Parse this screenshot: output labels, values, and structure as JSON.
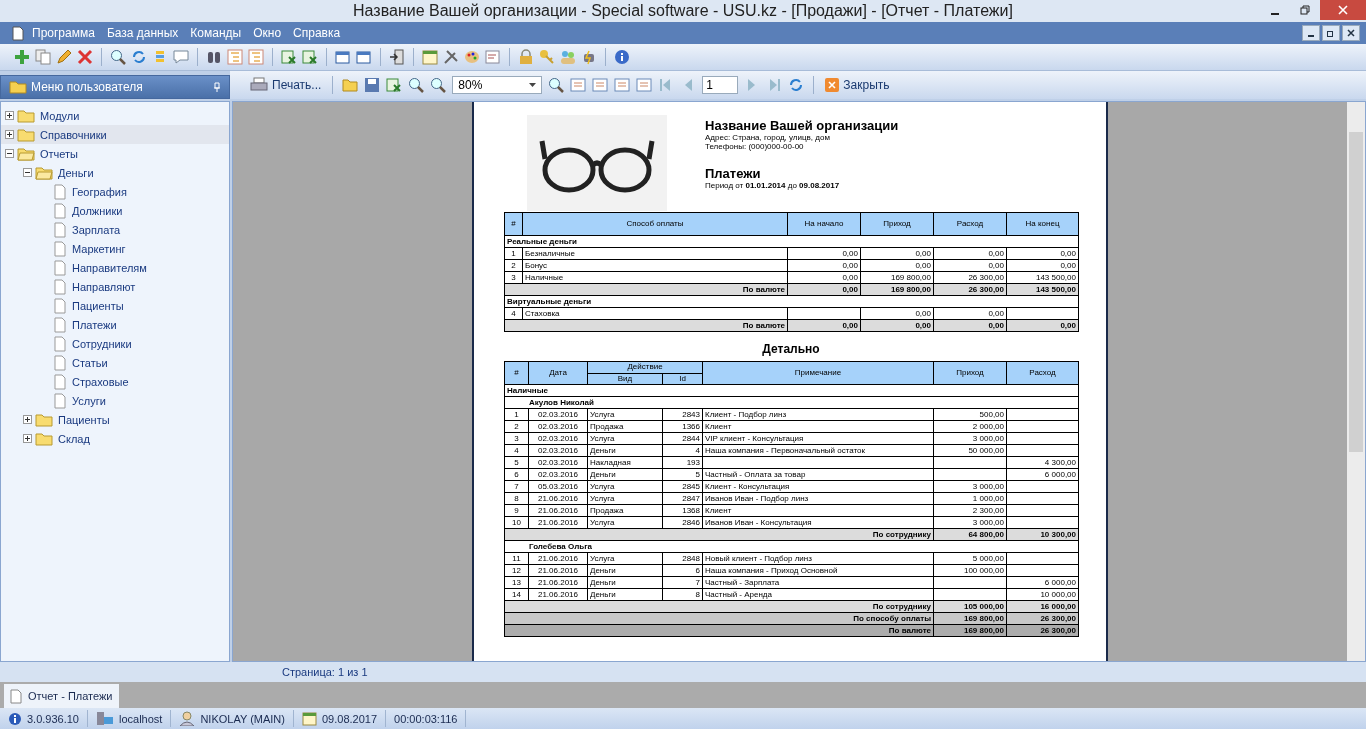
{
  "window": {
    "title": "Название Вашей организации - Special software - USU.kz - [Продажи] - [Отчет - Платежи]"
  },
  "menu": [
    "Программа",
    "База данных",
    "Команды",
    "Окно",
    "Справка"
  ],
  "sidebar": {
    "title": "Меню пользователя",
    "tree": [
      {
        "label": "Модули",
        "kind": "folder",
        "expanded": false,
        "selected": false
      },
      {
        "label": "Справочники",
        "kind": "folder",
        "expanded": false,
        "selected": true
      },
      {
        "label": "Отчеты",
        "kind": "folder",
        "expanded": true,
        "selected": false,
        "children": [
          {
            "label": "Деньги",
            "kind": "folder",
            "expanded": true,
            "selected": false,
            "children": [
              {
                "label": "География",
                "kind": "file",
                "selected": false
              },
              {
                "label": "Должники",
                "kind": "file",
                "selected": false
              },
              {
                "label": "Зарплата",
                "kind": "file",
                "selected": false
              },
              {
                "label": "Маркетинг",
                "kind": "file",
                "selected": false
              },
              {
                "label": "Направителям",
                "kind": "file",
                "selected": false
              },
              {
                "label": "Направляют",
                "kind": "file",
                "selected": false
              },
              {
                "label": "Пациенты",
                "kind": "file",
                "selected": false
              },
              {
                "label": "Платежи",
                "kind": "file",
                "selected": false
              },
              {
                "label": "Сотрудники",
                "kind": "file",
                "selected": false
              },
              {
                "label": "Статьи",
                "kind": "file",
                "selected": false
              },
              {
                "label": "Страховые",
                "kind": "file",
                "selected": false
              },
              {
                "label": "Услуги",
                "kind": "file",
                "selected": false
              }
            ]
          },
          {
            "label": "Пациенты",
            "kind": "folder",
            "expanded": false,
            "selected": false
          },
          {
            "label": "Склад",
            "kind": "folder",
            "expanded": false,
            "selected": false
          }
        ]
      }
    ]
  },
  "report_toolbar": {
    "print": "Печать...",
    "zoom": "80%",
    "page": "1",
    "close": "Закрыть"
  },
  "report": {
    "org_name": "Название Вашей организации",
    "address": "Адрес: Страна, город, улицв, дом",
    "phone": "Телефоны: (000)000-00-00",
    "title": "Платежи",
    "period": "Период от **01.01.2014** до **09.08.2017**",
    "summary": {
      "columns": [
        "#",
        "Способ оплаты",
        "На начало",
        "Приход",
        "Расход",
        "На конец"
      ],
      "sections": [
        {
          "title": "Реальные деньги",
          "rows": [
            {
              "num": "1",
              "name": "Безналичные",
              "start": "0,00",
              "income": "0,00",
              "expense": "0,00",
              "end": "0,00"
            },
            {
              "num": "2",
              "name": "Бонус",
              "start": "0,00",
              "income": "0,00",
              "expense": "0,00",
              "end": "0,00"
            },
            {
              "num": "3",
              "name": "Наличные",
              "start": "0,00",
              "income": "169 800,00",
              "expense": "26 300,00",
              "end": "143 500,00"
            }
          ],
          "total": {
            "label": "По валюте",
            "start": "0,00",
            "income": "169 800,00",
            "expense": "26 300,00",
            "end": "143 500,00"
          }
        },
        {
          "title": "Виртуальные деньги",
          "rows": [
            {
              "num": "4",
              "name": "Стаховка",
              "income": "0,00",
              "expense": "0,00"
            }
          ],
          "total": {
            "label": "По валюте",
            "start": "0,00",
            "income": "0,00",
            "expense": "0,00",
            "end": "0,00"
          }
        }
      ]
    },
    "detail_title": "Детально",
    "detail": {
      "columns": [
        "#",
        "Дата",
        "Действие",
        "Вид",
        "Id",
        "Примечание",
        "Приход",
        "Расход"
      ],
      "groups": [
        {
          "title": "Наличные",
          "employees": [
            {
              "name": "Акулов Николай",
              "rows": [
                {
                  "num": "1",
                  "date": "02.03.2016",
                  "action": "Услуга",
                  "action_id": "2843",
                  "note": "Клиент - Подбор линз",
                  "income": "500,00"
                },
                {
                  "num": "2",
                  "date": "02.03.2016",
                  "action": "Продажа",
                  "action_id": "1366",
                  "note": "Клиент",
                  "income": "2 000,00"
                },
                {
                  "num": "3",
                  "date": "02.03.2016",
                  "action": "Услуга",
                  "action_id": "2844",
                  "note": "VIP клиент - Консультация",
                  "income": "3 000,00"
                },
                {
                  "num": "4",
                  "date": "02.03.2016",
                  "action": "Деньги",
                  "action_id": "4",
                  "note": "Наша компания - Первоначальный остаток",
                  "income": "50 000,00"
                },
                {
                  "num": "5",
                  "date": "02.03.2016",
                  "action": "Накладная",
                  "action_id": "193",
                  "expense": "4 300,00"
                },
                {
                  "num": "6",
                  "date": "02.03.2016",
                  "action": "Деньги",
                  "action_id": "5",
                  "note": "Частный - Оплата за товар",
                  "expense": "6 000,00"
                },
                {
                  "num": "7",
                  "date": "05.03.2016",
                  "action": "Услуга",
                  "action_id": "2845",
                  "note": "Клиент - Консультация",
                  "income": "3 000,00"
                },
                {
                  "num": "8",
                  "date": "21.06.2016",
                  "action": "Услуга",
                  "action_id": "2847",
                  "note": "Иванов Иван - Подбор линз",
                  "income": "1 000,00"
                },
                {
                  "num": "9",
                  "date": "21.06.2016",
                  "action": "Продажа",
                  "action_id": "1368",
                  "note": "Клиент",
                  "income": "2 300,00"
                },
                {
                  "num": "10",
                  "date": "21.06.2016",
                  "action": "Услуга",
                  "action_id": "2846",
                  "note": "Иванов Иван - Консультация",
                  "income": "3 000,00"
                }
              ],
              "total": {
                "label": "По сотруднику",
                "income": "64 800,00",
                "expense": "10 300,00"
              }
            },
            {
              "name": "Голебева Ольга",
              "rows": [
                {
                  "num": "11",
                  "date": "21.06.2016",
                  "action": "Услуга",
                  "action_id": "2848",
                  "note": "Новый клиент - Подбор линз",
                  "income": "5 000,00"
                },
                {
                  "num": "12",
                  "date": "21.06.2016",
                  "action": "Деньги",
                  "action_id": "6",
                  "note": "Наша компания - Приход Основной",
                  "income": "100 000,00"
                },
                {
                  "num": "13",
                  "date": "21.06.2016",
                  "action": "Деньги",
                  "action_id": "7",
                  "note": "Частный - Зарплата",
                  "expense": "6 000,00"
                },
                {
                  "num": "14",
                  "date": "21.06.2016",
                  "action": "Деньги",
                  "action_id": "8",
                  "note": "Частный - Аренда",
                  "expense": "10 000,00"
                }
              ],
              "total": {
                "label": "По сотруднику",
                "income": "105 000,00",
                "expense": "16 000,00"
              }
            }
          ],
          "total": {
            "label": "По способу оплаты",
            "income": "169 800,00",
            "expense": "26 300,00"
          }
        }
      ],
      "grand_total": {
        "label": "По валюте",
        "income": "169 800,00",
        "expense": "26 300,00"
      }
    }
  },
  "page_status": "Страница: 1 из 1",
  "tabs": [
    {
      "label": "Отчет - Платежи",
      "selected": true
    }
  ],
  "status_bar": [
    {
      "kind": "version",
      "text": "3.0.936.10"
    },
    {
      "kind": "server",
      "text": "localhost"
    },
    {
      "kind": "user",
      "text": "NIKOLAY (MAIN)"
    },
    {
      "kind": "date",
      "text": "09.08.2017"
    },
    {
      "kind": "timer",
      "text": "00:00:03:116"
    }
  ]
}
